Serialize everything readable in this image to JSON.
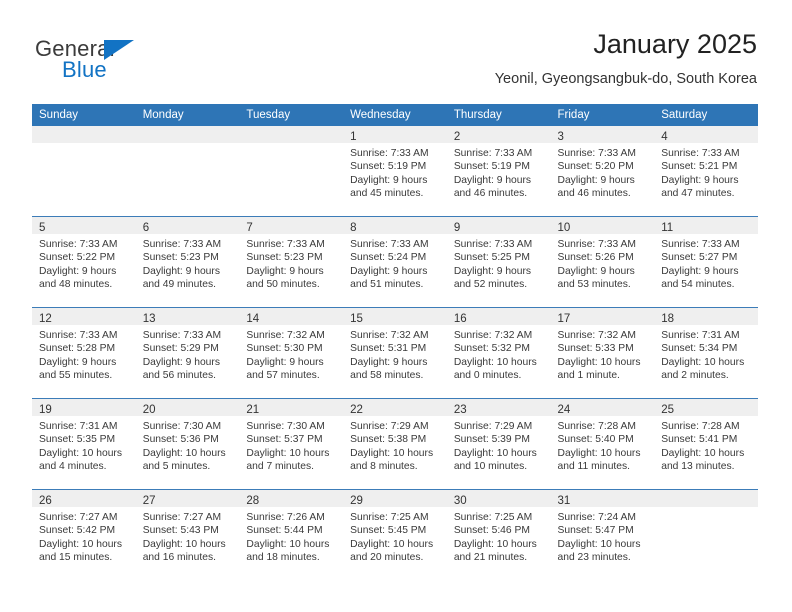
{
  "brand": {
    "name_part1": "General",
    "name_part2": "Blue"
  },
  "header": {
    "title": "January 2025",
    "location": "Yeonil, Gyeongsangbuk-do, South Korea"
  },
  "colors": {
    "header_blue": "#2E75B6",
    "brand_blue": "#1273C4",
    "daynum_band": "#EFEFEF",
    "row_separator": "#3C7CB8"
  },
  "weekday_headers": [
    "Sunday",
    "Monday",
    "Tuesday",
    "Wednesday",
    "Thursday",
    "Friday",
    "Saturday"
  ],
  "weeks": [
    [
      {
        "day": "",
        "empty": true,
        "lines": []
      },
      {
        "day": "",
        "empty": true,
        "lines": []
      },
      {
        "day": "",
        "empty": true,
        "lines": []
      },
      {
        "day": "1",
        "lines": [
          "Sunrise: 7:33 AM",
          "Sunset: 5:19 PM",
          "Daylight: 9 hours",
          "and 45 minutes."
        ]
      },
      {
        "day": "2",
        "lines": [
          "Sunrise: 7:33 AM",
          "Sunset: 5:19 PM",
          "Daylight: 9 hours",
          "and 46 minutes."
        ]
      },
      {
        "day": "3",
        "lines": [
          "Sunrise: 7:33 AM",
          "Sunset: 5:20 PM",
          "Daylight: 9 hours",
          "and 46 minutes."
        ]
      },
      {
        "day": "4",
        "lines": [
          "Sunrise: 7:33 AM",
          "Sunset: 5:21 PM",
          "Daylight: 9 hours",
          "and 47 minutes."
        ]
      }
    ],
    [
      {
        "day": "5",
        "lines": [
          "Sunrise: 7:33 AM",
          "Sunset: 5:22 PM",
          "Daylight: 9 hours",
          "and 48 minutes."
        ]
      },
      {
        "day": "6",
        "lines": [
          "Sunrise: 7:33 AM",
          "Sunset: 5:23 PM",
          "Daylight: 9 hours",
          "and 49 minutes."
        ]
      },
      {
        "day": "7",
        "lines": [
          "Sunrise: 7:33 AM",
          "Sunset: 5:23 PM",
          "Daylight: 9 hours",
          "and 50 minutes."
        ]
      },
      {
        "day": "8",
        "lines": [
          "Sunrise: 7:33 AM",
          "Sunset: 5:24 PM",
          "Daylight: 9 hours",
          "and 51 minutes."
        ]
      },
      {
        "day": "9",
        "lines": [
          "Sunrise: 7:33 AM",
          "Sunset: 5:25 PM",
          "Daylight: 9 hours",
          "and 52 minutes."
        ]
      },
      {
        "day": "10",
        "lines": [
          "Sunrise: 7:33 AM",
          "Sunset: 5:26 PM",
          "Daylight: 9 hours",
          "and 53 minutes."
        ]
      },
      {
        "day": "11",
        "lines": [
          "Sunrise: 7:33 AM",
          "Sunset: 5:27 PM",
          "Daylight: 9 hours",
          "and 54 minutes."
        ]
      }
    ],
    [
      {
        "day": "12",
        "lines": [
          "Sunrise: 7:33 AM",
          "Sunset: 5:28 PM",
          "Daylight: 9 hours",
          "and 55 minutes."
        ]
      },
      {
        "day": "13",
        "lines": [
          "Sunrise: 7:33 AM",
          "Sunset: 5:29 PM",
          "Daylight: 9 hours",
          "and 56 minutes."
        ]
      },
      {
        "day": "14",
        "lines": [
          "Sunrise: 7:32 AM",
          "Sunset: 5:30 PM",
          "Daylight: 9 hours",
          "and 57 minutes."
        ]
      },
      {
        "day": "15",
        "lines": [
          "Sunrise: 7:32 AM",
          "Sunset: 5:31 PM",
          "Daylight: 9 hours",
          "and 58 minutes."
        ]
      },
      {
        "day": "16",
        "lines": [
          "Sunrise: 7:32 AM",
          "Sunset: 5:32 PM",
          "Daylight: 10 hours",
          "and 0 minutes."
        ]
      },
      {
        "day": "17",
        "lines": [
          "Sunrise: 7:32 AM",
          "Sunset: 5:33 PM",
          "Daylight: 10 hours",
          "and 1 minute."
        ]
      },
      {
        "day": "18",
        "lines": [
          "Sunrise: 7:31 AM",
          "Sunset: 5:34 PM",
          "Daylight: 10 hours",
          "and 2 minutes."
        ]
      }
    ],
    [
      {
        "day": "19",
        "lines": [
          "Sunrise: 7:31 AM",
          "Sunset: 5:35 PM",
          "Daylight: 10 hours",
          "and 4 minutes."
        ]
      },
      {
        "day": "20",
        "lines": [
          "Sunrise: 7:30 AM",
          "Sunset: 5:36 PM",
          "Daylight: 10 hours",
          "and 5 minutes."
        ]
      },
      {
        "day": "21",
        "lines": [
          "Sunrise: 7:30 AM",
          "Sunset: 5:37 PM",
          "Daylight: 10 hours",
          "and 7 minutes."
        ]
      },
      {
        "day": "22",
        "lines": [
          "Sunrise: 7:29 AM",
          "Sunset: 5:38 PM",
          "Daylight: 10 hours",
          "and 8 minutes."
        ]
      },
      {
        "day": "23",
        "lines": [
          "Sunrise: 7:29 AM",
          "Sunset: 5:39 PM",
          "Daylight: 10 hours",
          "and 10 minutes."
        ]
      },
      {
        "day": "24",
        "lines": [
          "Sunrise: 7:28 AM",
          "Sunset: 5:40 PM",
          "Daylight: 10 hours",
          "and 11 minutes."
        ]
      },
      {
        "day": "25",
        "lines": [
          "Sunrise: 7:28 AM",
          "Sunset: 5:41 PM",
          "Daylight: 10 hours",
          "and 13 minutes."
        ]
      }
    ],
    [
      {
        "day": "26",
        "lines": [
          "Sunrise: 7:27 AM",
          "Sunset: 5:42 PM",
          "Daylight: 10 hours",
          "and 15 minutes."
        ]
      },
      {
        "day": "27",
        "lines": [
          "Sunrise: 7:27 AM",
          "Sunset: 5:43 PM",
          "Daylight: 10 hours",
          "and 16 minutes."
        ]
      },
      {
        "day": "28",
        "lines": [
          "Sunrise: 7:26 AM",
          "Sunset: 5:44 PM",
          "Daylight: 10 hours",
          "and 18 minutes."
        ]
      },
      {
        "day": "29",
        "lines": [
          "Sunrise: 7:25 AM",
          "Sunset: 5:45 PM",
          "Daylight: 10 hours",
          "and 20 minutes."
        ]
      },
      {
        "day": "30",
        "lines": [
          "Sunrise: 7:25 AM",
          "Sunset: 5:46 PM",
          "Daylight: 10 hours",
          "and 21 minutes."
        ]
      },
      {
        "day": "31",
        "lines": [
          "Sunrise: 7:24 AM",
          "Sunset: 5:47 PM",
          "Daylight: 10 hours",
          "and 23 minutes."
        ]
      },
      {
        "day": "",
        "empty": true,
        "lines": []
      }
    ]
  ]
}
